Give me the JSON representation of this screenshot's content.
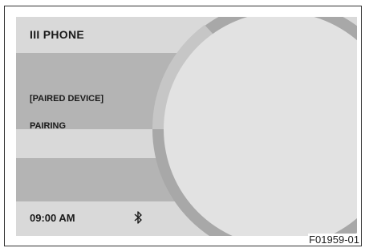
{
  "header": {
    "title": "III  PHONE"
  },
  "menu": {
    "items": [
      {
        "label": "[PAIRED DEVICE]"
      },
      {
        "label": "PAIRING"
      }
    ]
  },
  "status": {
    "time": "09:00 AM",
    "bluetooth_icon": "bluetooth-icon"
  },
  "figure_ref": "F01959-01",
  "colors": {
    "band_light": "#d9d9d9",
    "band_dark": "#b4b4b4",
    "dial_face": "#e2e2e2",
    "dial_ring": "#a8a8a8"
  }
}
